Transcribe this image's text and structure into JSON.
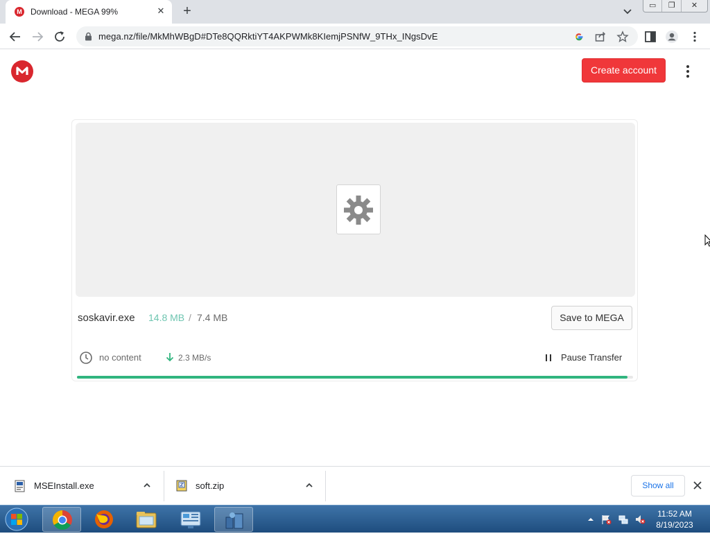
{
  "browser": {
    "tab": {
      "title": "Download - MEGA 99%",
      "favicon_letter": "M",
      "close_glyph": "✕"
    },
    "new_tab_glyph": "+",
    "url": "mega.nz/file/MkMhWBgD#DTe8QQRktiYT4AKPWMk8KIemjPSNfW_9THx_INgsDvE",
    "window_controls": [
      "▭",
      "❐",
      "✕"
    ]
  },
  "page": {
    "create_account_label": "Create account",
    "file": {
      "name": "soskavir.exe",
      "downloaded": "14.8 MB",
      "separator": "/",
      "total": "7.4 MB",
      "save_label": "Save to MEGA",
      "time_status": "no content",
      "speed": "2.3 MB/s",
      "pause_label": "Pause Transfer",
      "progress_percent": 99
    }
  },
  "downloads": {
    "items": [
      {
        "name": "MSEInstall.exe",
        "icon": "installer-file-icon"
      },
      {
        "name": "soft.zip",
        "icon": "zip-file-icon"
      }
    ],
    "show_all_label": "Show all"
  },
  "taskbar": {
    "apps": [
      "chrome",
      "firefox",
      "file-explorer",
      "control-panel",
      "network-app"
    ],
    "time": "11:52 AM",
    "date": "8/19/2023"
  },
  "colors": {
    "mega_red": "#d9272e",
    "create_button": "#f0373a",
    "progress": "#31b57f",
    "downloaded_text": "#6ec5b0"
  }
}
